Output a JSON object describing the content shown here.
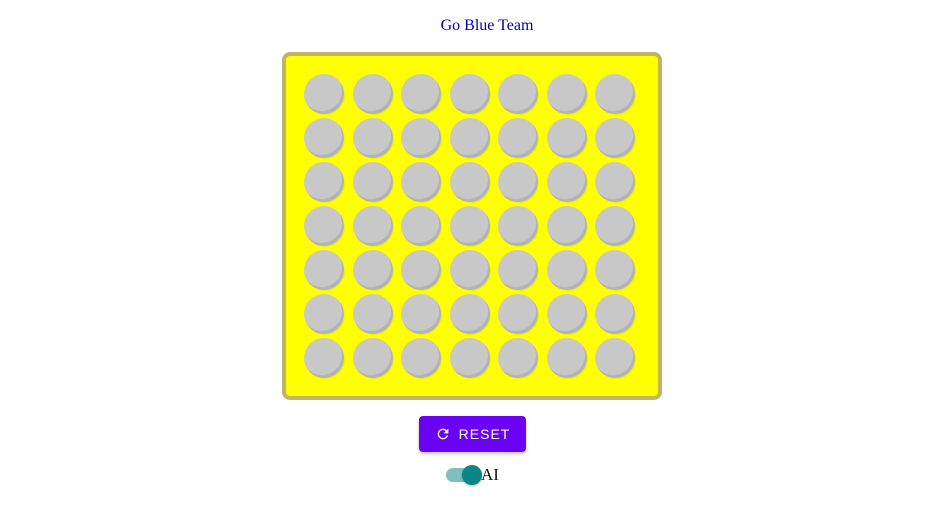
{
  "status": {
    "text": "Go Blue Team"
  },
  "board": {
    "rows": 7,
    "columns": 7,
    "cells": [
      [
        "empty",
        "empty",
        "empty",
        "empty",
        "empty",
        "empty",
        "empty"
      ],
      [
        "empty",
        "empty",
        "empty",
        "empty",
        "empty",
        "empty",
        "empty"
      ],
      [
        "empty",
        "empty",
        "empty",
        "empty",
        "empty",
        "empty",
        "empty"
      ],
      [
        "empty",
        "empty",
        "empty",
        "empty",
        "empty",
        "empty",
        "empty"
      ],
      [
        "empty",
        "empty",
        "empty",
        "empty",
        "empty",
        "empty",
        "empty"
      ],
      [
        "empty",
        "empty",
        "empty",
        "empty",
        "empty",
        "empty",
        "empty"
      ],
      [
        "empty",
        "empty",
        "empty",
        "empty",
        "empty",
        "empty",
        "empty"
      ]
    ],
    "colors": {
      "board": "#ffff00",
      "frame": "#bfb663",
      "empty_cell": "#c8c8c8"
    }
  },
  "controls": {
    "reset_label": "RESET",
    "reset_icon": "refresh-icon",
    "reset_color": "#6a00f4",
    "ai_toggle": {
      "label": "AI",
      "checked": true,
      "color": "#0b8585"
    }
  }
}
